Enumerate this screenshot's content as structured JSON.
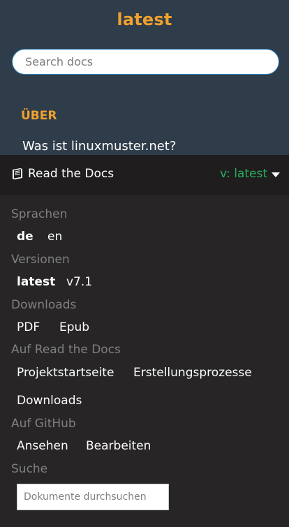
{
  "nav": {
    "project_title": "latest",
    "search_placeholder": "Search docs",
    "caption": "ÜBER",
    "toc_link": "Was ist linuxmuster.net?"
  },
  "rtd": {
    "brand_label": "Read the Docs",
    "version_label": "v: latest",
    "sections": {
      "languages": {
        "label": "Sprachen",
        "items": [
          "de",
          "en"
        ],
        "active": "de"
      },
      "versions": {
        "label": "Versionen",
        "items": [
          "latest",
          "v7.1"
        ],
        "active": "latest"
      },
      "downloads": {
        "label": "Downloads",
        "items": [
          "PDF",
          "Epub"
        ]
      },
      "on_rtd": {
        "label": "Auf Read the Docs",
        "items": [
          "Projektstartseite",
          "Erstellungsprozesse",
          "Downloads"
        ]
      },
      "on_github": {
        "label": "Auf GitHub",
        "items": [
          "Ansehen",
          "Bearbeiten"
        ]
      },
      "search": {
        "label": "Suche",
        "placeholder": "Dokumente durchsuchen"
      }
    }
  },
  "colors": {
    "nav_bg": "#2f3c49",
    "accent_orange": "#f0a12e",
    "version_green": "#27ae60",
    "panel_bg": "#272525",
    "bar_bg": "#1f1d1d",
    "muted_label": "#808080"
  },
  "icons": {
    "brand": "book-icon",
    "version_toggle": "caret-down-icon"
  }
}
